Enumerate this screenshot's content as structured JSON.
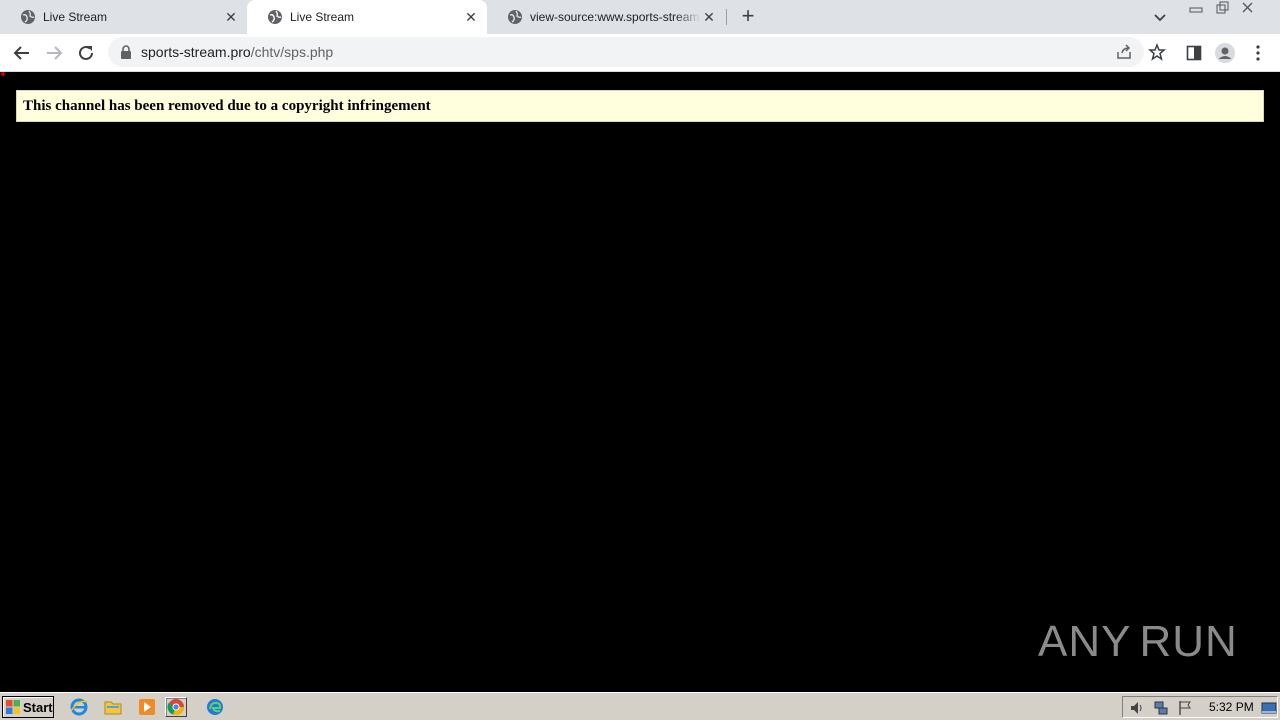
{
  "tabs": [
    {
      "title": "Live Stream"
    },
    {
      "title": "Live Stream"
    },
    {
      "title": "view-source:www.sports-stream.pro"
    }
  ],
  "toolbar": {
    "url_host": "sports-stream.pro",
    "url_path": "/chtv/sps.php"
  },
  "page": {
    "notice": "This channel has been removed due to a copyright infringement"
  },
  "watermark": {
    "left": "ANY",
    "right": "RUN"
  },
  "taskbar": {
    "start_label": "Start",
    "clock": "5:32 PM"
  }
}
